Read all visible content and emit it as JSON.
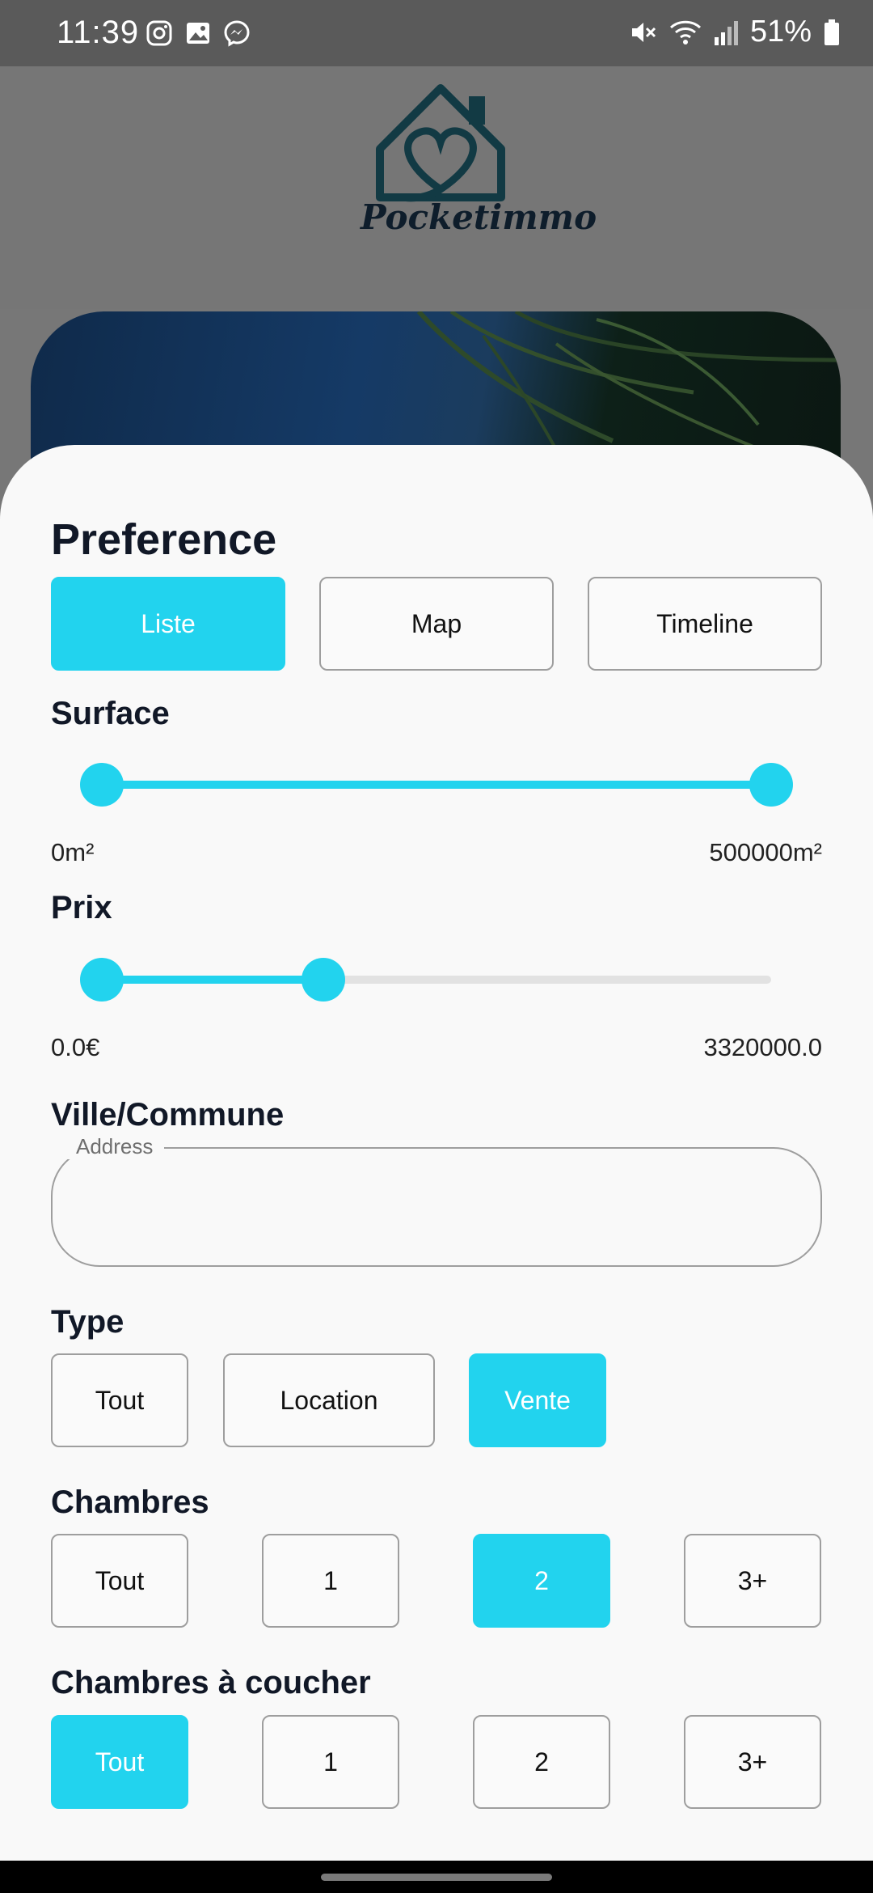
{
  "status_bar": {
    "time": "11:39",
    "battery": "51%",
    "left_icons": [
      "instagram-icon",
      "gallery-icon",
      "messenger-icon"
    ],
    "right_icons": [
      "mute-icon",
      "wifi-icon",
      "signal-icon",
      "battery-icon"
    ]
  },
  "app": {
    "brand": "Pocketimmo",
    "accent_color": "#22d3ee"
  },
  "preference": {
    "title": "Preference",
    "view_options": [
      {
        "label": "Liste",
        "active": true
      },
      {
        "label": "Map",
        "active": false
      },
      {
        "label": "Timeline",
        "active": false
      }
    ]
  },
  "surface": {
    "title": "Surface",
    "min_label": "0m²",
    "max_label": "500000m²",
    "range_fraction": [
      0.0,
      1.0
    ]
  },
  "prix": {
    "title": "Prix",
    "min_label": "0.0€",
    "max_label": "3320000.0",
    "range_fraction": [
      0.0,
      0.33
    ]
  },
  "ville": {
    "title": "Ville/Commune",
    "address_label": "Address",
    "address_value": ""
  },
  "type": {
    "title": "Type",
    "options": [
      {
        "label": "Tout",
        "active": false
      },
      {
        "label": "Location",
        "active": false
      },
      {
        "label": "Vente",
        "active": true
      }
    ]
  },
  "chambres": {
    "title": "Chambres",
    "options": [
      {
        "label": "Tout",
        "active": false
      },
      {
        "label": "1",
        "active": false
      },
      {
        "label": "2",
        "active": true
      },
      {
        "label": "3+",
        "active": false
      }
    ]
  },
  "chambres_coucher": {
    "title": "Chambres à coucher",
    "options": [
      {
        "label": "Tout",
        "active": true
      },
      {
        "label": "1",
        "active": false
      },
      {
        "label": "2",
        "active": false
      },
      {
        "label": "3+",
        "active": false
      }
    ]
  }
}
